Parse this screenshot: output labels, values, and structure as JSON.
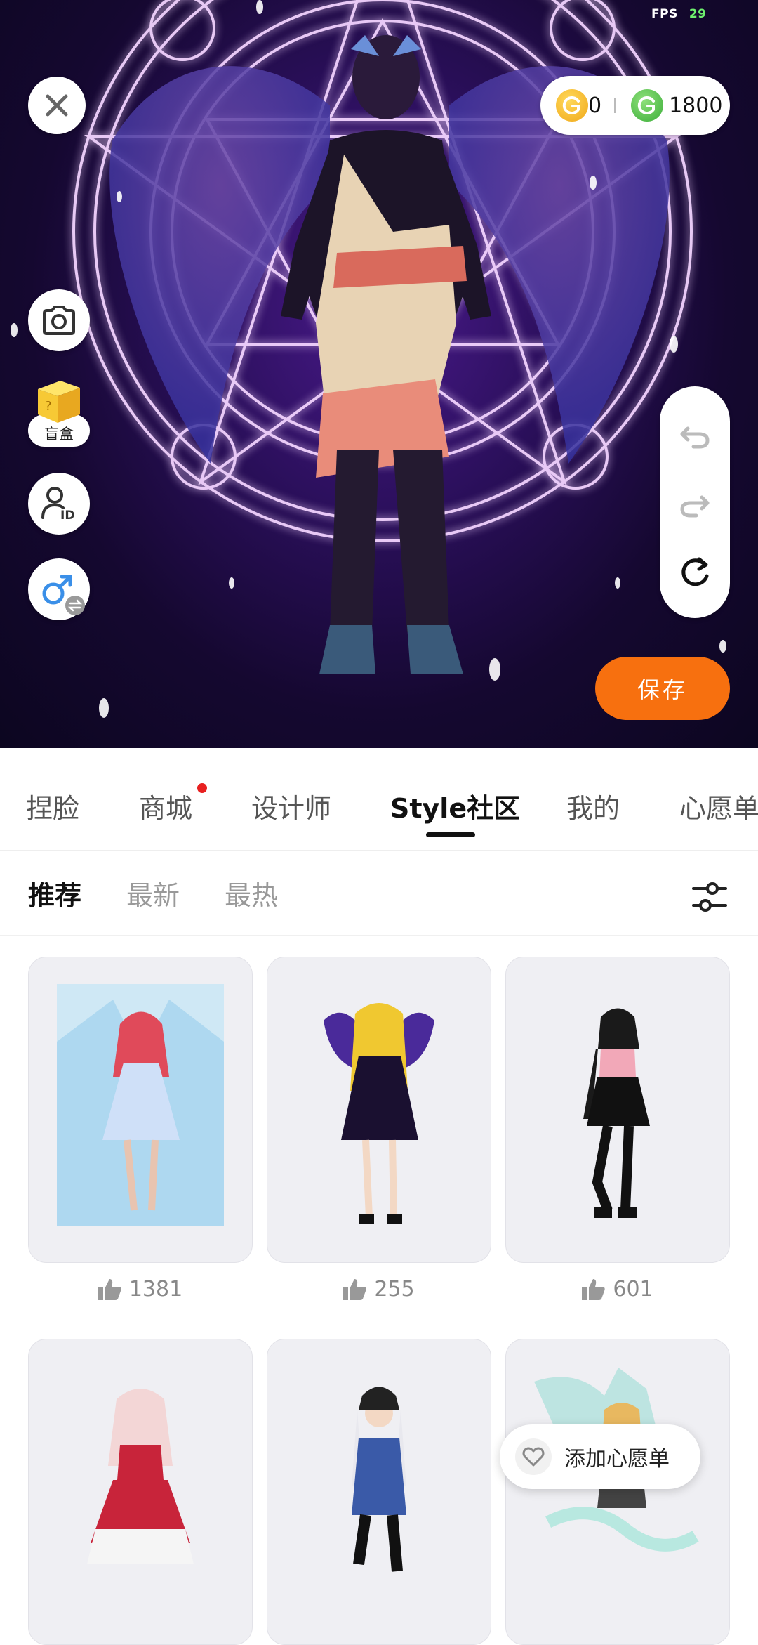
{
  "status": {
    "fps_label": "FPS",
    "fps_value": "29"
  },
  "currency": {
    "gold": "0",
    "green": "1800"
  },
  "left_tools": {
    "blindbox_label": "盲盒"
  },
  "save_label": "保存",
  "main_tabs": [
    {
      "label": "捏脸"
    },
    {
      "label": "商城",
      "has_dot": true
    },
    {
      "label": "设计师"
    },
    {
      "label": "Style社区",
      "active": true
    },
    {
      "label": "我的"
    },
    {
      "label": "心愿单"
    }
  ],
  "sub_tabs": [
    {
      "label": "推荐",
      "active": true
    },
    {
      "label": "最新"
    },
    {
      "label": "最热"
    }
  ],
  "cards": [
    {
      "likes": "1381"
    },
    {
      "likes": "255"
    },
    {
      "likes": "601"
    },
    {
      "likes": ""
    },
    {
      "likes": ""
    },
    {
      "likes": ""
    }
  ],
  "wishlist_button": "添加心愿单",
  "colors": {
    "accent": "#f7700f",
    "badge": "#e82020",
    "scene_bg": "#150830"
  }
}
